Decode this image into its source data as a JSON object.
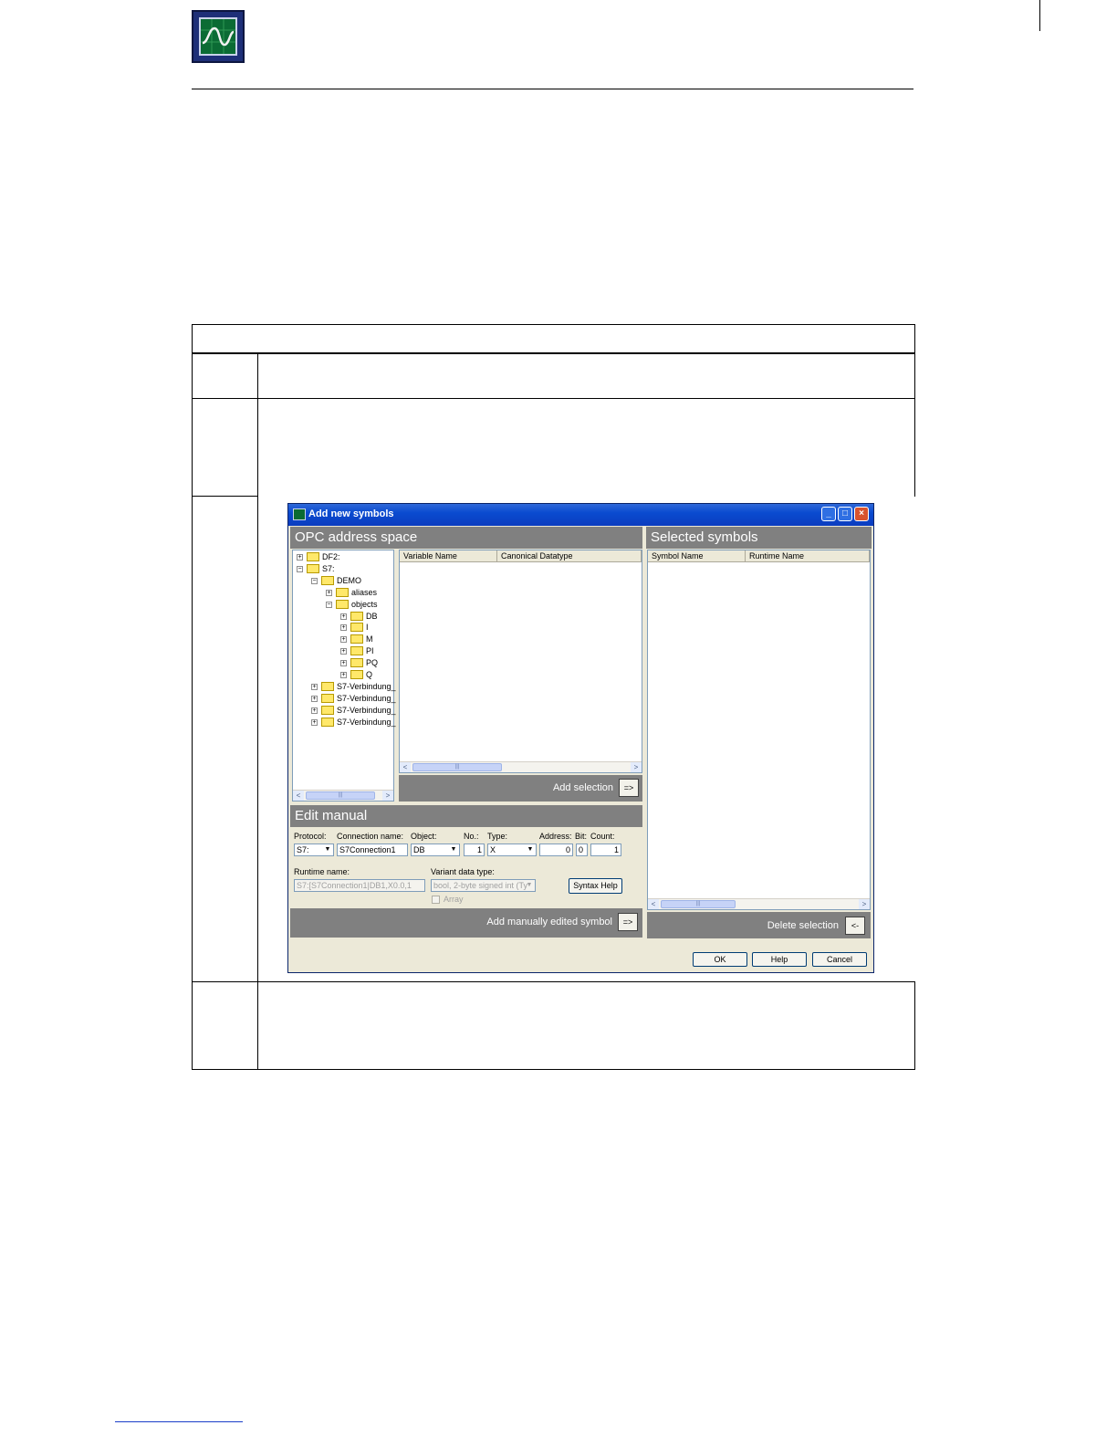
{
  "dialog": {
    "title": "Add new symbols",
    "opc": {
      "header": "OPC address space",
      "tree": [
        {
          "label": "DF2:",
          "level": 0,
          "expanded": false
        },
        {
          "label": "S7:",
          "level": 0,
          "expanded": true
        },
        {
          "label": "DEMO",
          "level": 1,
          "expanded": true
        },
        {
          "label": "aliases",
          "level": 2,
          "expanded": false
        },
        {
          "label": "objects",
          "level": 2,
          "expanded": true
        },
        {
          "label": "DB",
          "level": 3,
          "expanded": false
        },
        {
          "label": "I",
          "level": 3,
          "expanded": false
        },
        {
          "label": "M",
          "level": 3,
          "expanded": false
        },
        {
          "label": "PI",
          "level": 3,
          "expanded": false
        },
        {
          "label": "PQ",
          "level": 3,
          "expanded": false
        },
        {
          "label": "Q",
          "level": 3,
          "expanded": false
        },
        {
          "label": "S7-Verbindung_",
          "level": 1,
          "expanded": false
        },
        {
          "label": "S7-Verbindung_",
          "level": 1,
          "expanded": false
        },
        {
          "label": "S7-Verbindung_",
          "level": 1,
          "expanded": false
        },
        {
          "label": "S7-Verbindung_",
          "level": 1,
          "expanded": false
        }
      ],
      "columns": [
        "Variable Name",
        "Canonical Datatype"
      ],
      "add_selection_label": "Add selection",
      "add_button": "=>"
    },
    "edit_manual": {
      "header": "Edit manual",
      "protocol_label": "Protocol:",
      "protocol_value": "S7:",
      "connection_name_label": "Connection name:",
      "connection_name_value": "S7Connection1",
      "object_label": "Object:",
      "object_value": "DB",
      "no_label": "No.:",
      "no_value": "1",
      "type_label": "Type:",
      "type_value": "X",
      "address_label": "Address:",
      "address_value": "0",
      "bit_label": "Bit:",
      "bit_value": "0",
      "count_label": "Count:",
      "count_value": "1",
      "runtime_name_label": "Runtime name:",
      "runtime_name_value": "S7:[S7Connection1|DB1,X0.0,1",
      "variant_label": "Variant data type:",
      "variant_value": "bool, 2-byte signed int (Ty",
      "syntax_help": "Syntax Help",
      "array_label": "Array",
      "add_manual_label": "Add manually edited symbol",
      "add_manual_button": "=>"
    },
    "selected": {
      "header": "Selected symbols",
      "columns": [
        "Symbol Name",
        "Runtime Name"
      ],
      "delete_selection_label": "Delete selection",
      "delete_button": "<-"
    },
    "buttons": {
      "ok": "OK",
      "help": "Help",
      "cancel": "Cancel"
    },
    "titlebar_buttons": {
      "minimize": "_",
      "maximize": "□",
      "close": "×"
    }
  }
}
